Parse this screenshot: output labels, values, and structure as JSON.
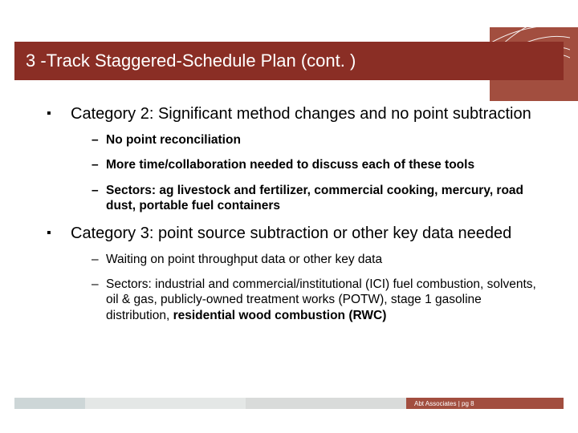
{
  "header": {
    "title": "3 -Track Staggered-Schedule Plan (cont. )"
  },
  "bullets": [
    {
      "text": "Category 2: Significant method changes and no point subtraction",
      "sub": [
        {
          "text": "No point reconciliation",
          "bold": true
        },
        {
          "text": "More time/collaboration needed to discuss each of these tools",
          "bold": true
        },
        {
          "text": "Sectors: ag livestock and fertilizer, commercial cooking, mercury, road dust, portable fuel containers",
          "bold": true
        }
      ]
    },
    {
      "text": "Category 3: point source subtraction or other key data needed",
      "sub": [
        {
          "text": "Waiting on point throughput data or other key data",
          "bold": false
        },
        {
          "plain_prefix": "Sectors: industrial and commercial/institutional (ICI) fuel combustion, solvents, oil & gas, publicly-owned treatment works (POTW), stage 1 gasoline distribution, ",
          "bold_suffix": "residential wood combustion (RWC)"
        }
      ]
    }
  ],
  "footer": {
    "label": "Abt Associates | pg 8"
  }
}
